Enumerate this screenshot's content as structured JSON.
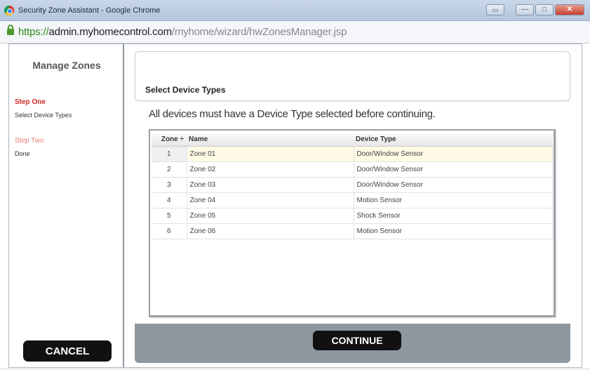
{
  "window": {
    "title": "Security Zone Assistant - Google Chrome",
    "extra_button": "▭",
    "minimize": "—",
    "maximize": "□",
    "close": "✕"
  },
  "address": {
    "scheme": "https://",
    "host": "admin.myhomecontrol.com",
    "path": "/myhome/wizard/hwZonesManager.jsp"
  },
  "sidebar": {
    "title": "Manage Zones",
    "steps": [
      {
        "title": "Step One",
        "desc": "Select Device Types"
      },
      {
        "title": "Step Two",
        "desc": "Done"
      }
    ],
    "cancel_label": "CANCEL"
  },
  "main": {
    "header_title": "Select Device Types",
    "instruction": "All devices must have a Device Type selected before continuing.",
    "table": {
      "columns": [
        "Zone ÷",
        "Name",
        "Device Type"
      ],
      "rows": [
        {
          "zone": "1",
          "name": "Zone   01",
          "type": "Door/Window Sensor"
        },
        {
          "zone": "2",
          "name": "Zone   02",
          "type": "Door/Window Sensor"
        },
        {
          "zone": "3",
          "name": "Zone   03",
          "type": "Door/Window Sensor"
        },
        {
          "zone": "4",
          "name": "Zone   04",
          "type": "Motion Sensor"
        },
        {
          "zone": "5",
          "name": "Zone   05",
          "type": "Shock Sensor"
        },
        {
          "zone": "6",
          "name": "Zone   06",
          "type": "Motion Sensor"
        }
      ]
    },
    "continue_label": "CONTINUE"
  },
  "colors": {
    "step_active": "#cc2a24",
    "step_inactive": "#e77d78",
    "url_scheme": "#2e8b1e",
    "footer": "#8f979f",
    "button": "#111111"
  }
}
